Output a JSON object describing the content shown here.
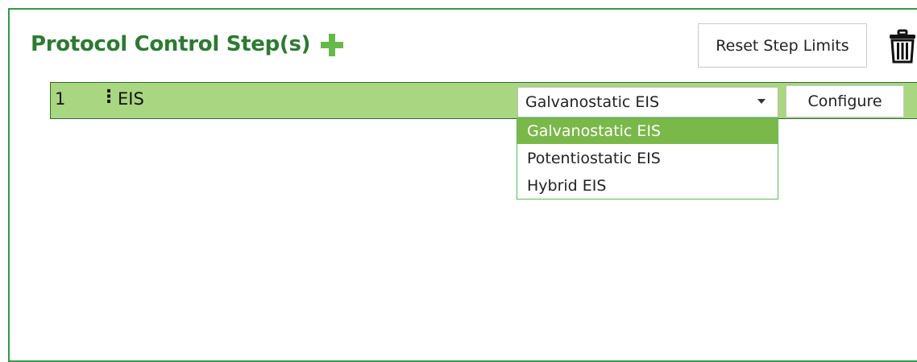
{
  "header": {
    "title": "Protocol Control Step(s)",
    "reset_label": "Reset Step Limits"
  },
  "icons": {
    "add": "plus-icon",
    "delete": "trash-icon",
    "drag": "vertical-ellipsis-icon",
    "dropdown": "chevron-down-icon"
  },
  "colors": {
    "frame": "#2e9b45",
    "title": "#2d7a32",
    "row_bg": "#a9d680",
    "selected_option": "#7ab84a"
  },
  "steps": [
    {
      "number": "1",
      "handle": "⋮",
      "name": "EIS",
      "selected_type": "Galvanostatic EIS",
      "configure_label": "Configure"
    }
  ],
  "dropdown": {
    "open": true,
    "options": [
      {
        "label": "Galvanostatic EIS",
        "selected": true
      },
      {
        "label": "Potentiostatic EIS",
        "selected": false
      },
      {
        "label": "Hybrid EIS",
        "selected": false
      }
    ]
  }
}
